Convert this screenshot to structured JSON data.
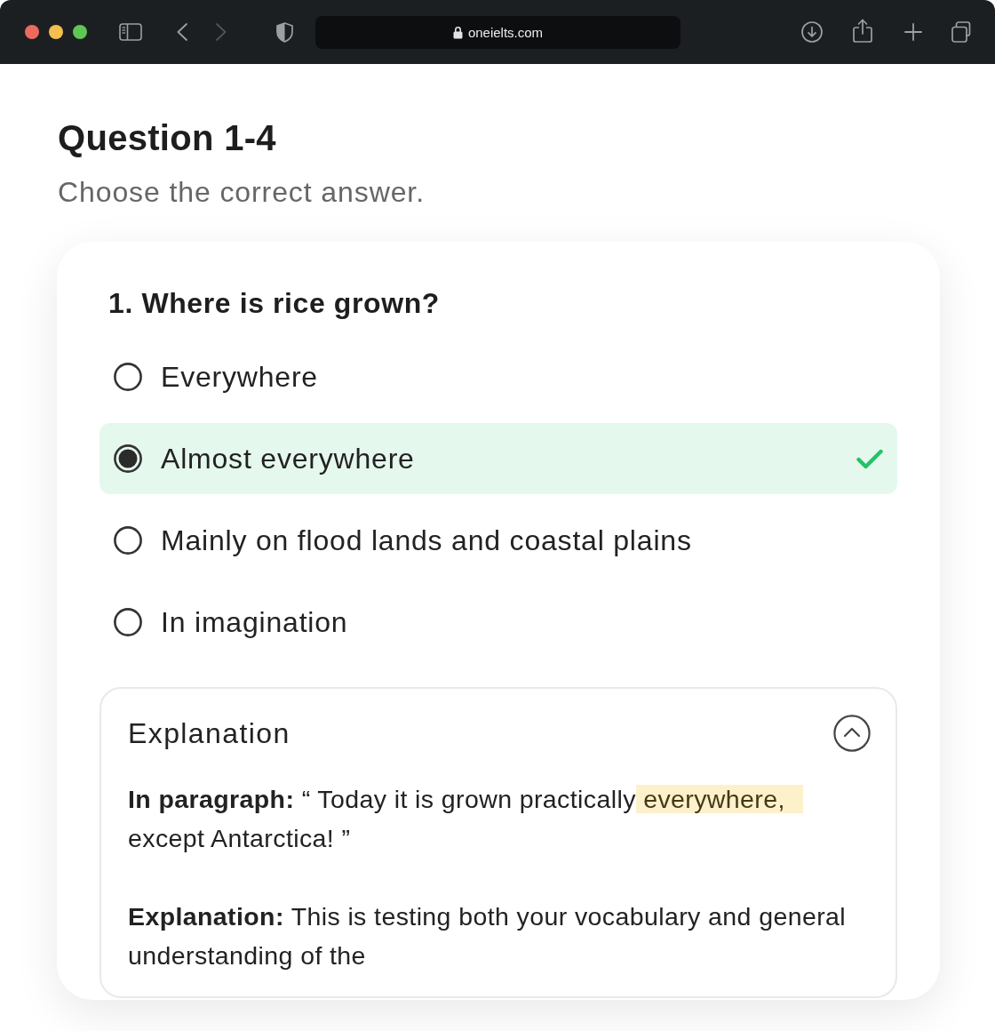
{
  "browser": {
    "url": "oneielts.com",
    "back": {
      "disabled": false
    },
    "forward": {
      "disabled": true
    }
  },
  "heading": {
    "title": "Question 1-4",
    "instruction": "Choose the correct answer."
  },
  "question": {
    "title": "1. Where is rice grown?",
    "options": [
      {
        "label": "Everywhere",
        "selected": false,
        "correct": false
      },
      {
        "label": "Almost everywhere",
        "selected": true,
        "correct": true
      },
      {
        "label": "Mainly on flood lands and coastal plains",
        "selected": false,
        "correct": false
      },
      {
        "label": "In imagination",
        "selected": false,
        "correct": false
      }
    ]
  },
  "explanation": {
    "title": "Explanation",
    "expanded": true,
    "paragraphs": [
      {
        "segments": [
          {
            "text": "**In paragraph:** “ Today it is grown practically",
            "highlight": false
          },
          {
            "text": "everywhere,",
            "highlight": true
          },
          {
            "text": "except Antarctica! ”",
            "highlight": false
          }
        ]
      },
      {
        "segments": [
          {
            "text": "**Explanation:** This is testing both your vocabulary and general understanding of the",
            "highlight": false
          }
        ]
      }
    ]
  }
}
